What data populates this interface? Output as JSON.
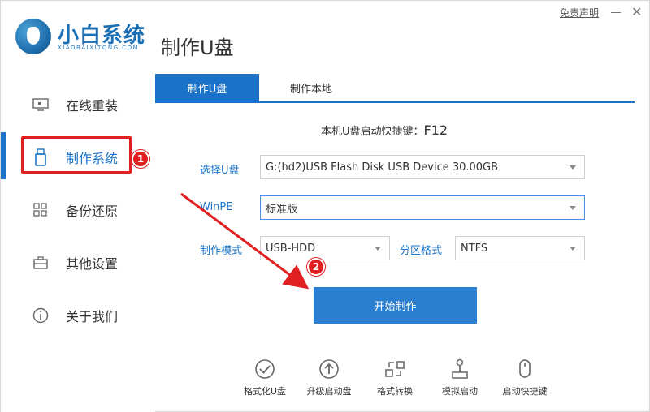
{
  "app": {
    "logo_title": "小白系统",
    "logo_sub": "XIAOBAIXITONG.COM",
    "page_title": "制作U盘",
    "top_link": "免责声明",
    "close_label": "✕"
  },
  "sidebar": {
    "items": [
      {
        "label": "在线重装",
        "icon": "monitor-icon"
      },
      {
        "label": "制作系统",
        "icon": "usb-icon",
        "active": true
      },
      {
        "label": "备份还原",
        "icon": "grid-icon"
      },
      {
        "label": "其他设置",
        "icon": "briefcase-icon"
      },
      {
        "label": "关于我们",
        "icon": "info-icon"
      }
    ]
  },
  "tabs": [
    {
      "label": "制作U盘",
      "active": true
    },
    {
      "label": "制作本地",
      "active": false
    }
  ],
  "hotkey": {
    "label": "本机U盘启动快捷键：",
    "key": "F12"
  },
  "form": {
    "usb_label": "选择U盘",
    "usb_value": "G:(hd2)USB Flash Disk USB Device 30.00GB",
    "winpe_label": "WinPE",
    "winpe_value": "标准版",
    "mode_label": "制作模式",
    "mode_value": "USB-HDD",
    "partition_label": "分区格式",
    "partition_value": "NTFS"
  },
  "start_button": "开始制作",
  "tools": [
    {
      "label": "格式化U盘",
      "icon": "check-circle-icon"
    },
    {
      "label": "升级启动盘",
      "icon": "upload-circle-icon"
    },
    {
      "label": "格式转换",
      "icon": "convert-icon"
    },
    {
      "label": "模拟启动",
      "icon": "joystick-icon"
    },
    {
      "label": "启动快捷键",
      "icon": "mouse-icon"
    }
  ],
  "annotations": {
    "badge1": "1",
    "badge2": "2"
  },
  "colors": {
    "accent": "#1a73c8",
    "callout": "#e02020"
  }
}
